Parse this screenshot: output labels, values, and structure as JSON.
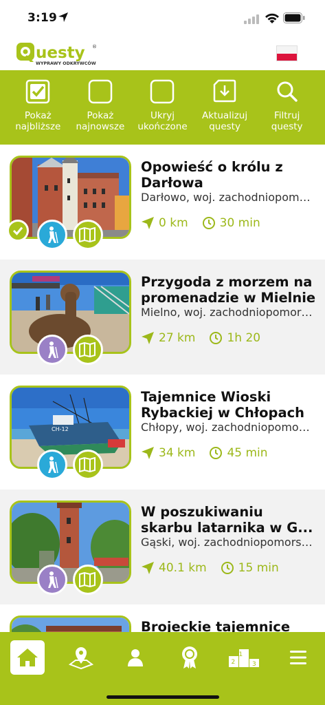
{
  "status": {
    "time": "3:19"
  },
  "brand": {
    "logo_text": "uesty",
    "logo_sub": "WYPRAWY ODKRYWCÓW",
    "reg": "®"
  },
  "toolbar": {
    "items": [
      {
        "line1": "Pokaż",
        "line2": "najbliższe"
      },
      {
        "line1": "Pokaż",
        "line2": "najnowsze"
      },
      {
        "line1": "Ukryj",
        "line2": "ukończone"
      },
      {
        "line1": "Aktualizuj",
        "line2": "questy"
      },
      {
        "line1": "Filtruj",
        "line2": "questy"
      }
    ]
  },
  "quests": [
    {
      "title1": "Opowieść o królu z",
      "title2": "Darłowa",
      "location": "Darłowo, woj. zachodniopomorskie",
      "distance": "0 km",
      "duration": "30 min"
    },
    {
      "title1": "Przygoda z morzem na",
      "title2": "promenadzie w Mielnie",
      "location": "Mielno, woj. zachodniopomorskie",
      "distance": "27 km",
      "duration": "1h 20"
    },
    {
      "title1": "Tajemnice Wioski",
      "title2": "Rybackiej w Chłopach",
      "location": "Chłopy, woj. zachodniopomorskie",
      "distance": "34 km",
      "duration": "45 min"
    },
    {
      "title1": "W poszukiwaniu",
      "title2": "skarbu latarnika w G...",
      "location": "Gąski, woj. zachodniopomorskie",
      "distance": "40.1 km",
      "duration": "15 min"
    },
    {
      "title1": "Brojeckie tajemnice",
      "title2": "",
      "location": "",
      "distance": "",
      "duration": ""
    }
  ],
  "boat_label": "CH-12",
  "podium": {
    "first": "1",
    "second": "2",
    "third": "3"
  },
  "colors": {
    "accent": "#a8c31a",
    "walk_blue": "#2aa9d8",
    "walk_purple": "#9a80c6"
  }
}
